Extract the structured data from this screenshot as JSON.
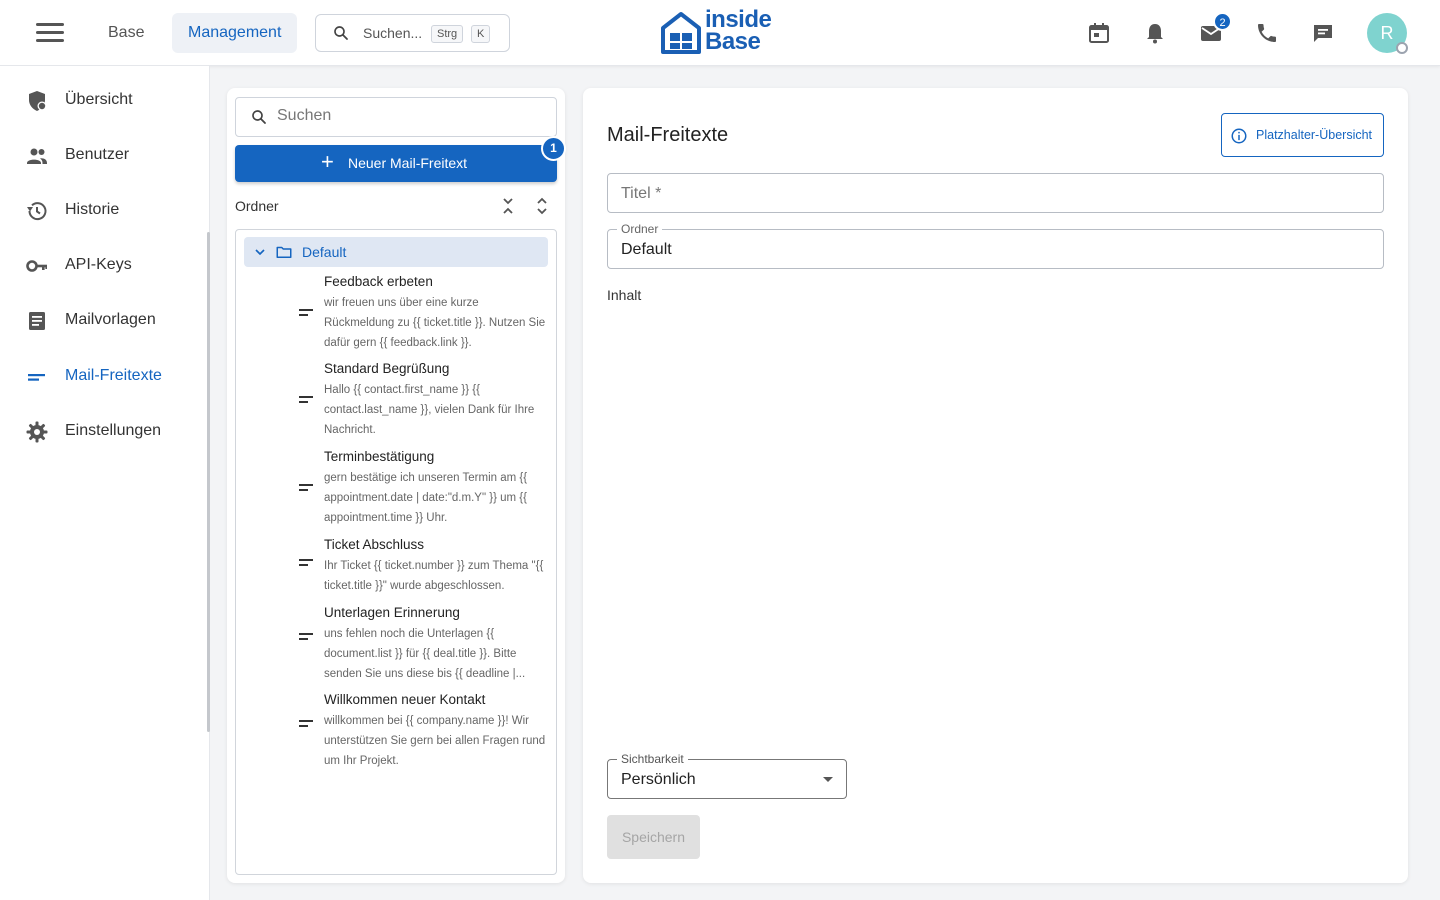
{
  "header": {
    "tabs": [
      {
        "label": "Base",
        "active": false
      },
      {
        "label": "Management",
        "active": true
      }
    ],
    "search": {
      "placeholder": "Suchen...",
      "kbd1": "Strg",
      "kbd2": "K"
    },
    "logo": {
      "line1": "inside",
      "line2": "Base"
    },
    "icons": [
      "calendar-icon",
      "bell-icon",
      "mail-icon",
      "phone-icon",
      "chat-icon"
    ],
    "mail_badge": "2",
    "avatar_initial": "R"
  },
  "sidebar": {
    "items": [
      {
        "label": "Übersicht",
        "icon": "shield-icon",
        "active": false
      },
      {
        "label": "Benutzer",
        "icon": "people-icon",
        "active": false
      },
      {
        "label": "Historie",
        "icon": "history-icon",
        "active": false
      },
      {
        "label": "API-Keys",
        "icon": "key-icon",
        "active": false
      },
      {
        "label": "Mailvorlagen",
        "icon": "document-icon",
        "active": false
      },
      {
        "label": "Mail-Freitexte",
        "icon": "short-text-icon",
        "active": true
      },
      {
        "label": "Einstellungen",
        "icon": "gear-icon",
        "active": false
      }
    ]
  },
  "left_panel": {
    "search_placeholder": "Suchen",
    "new_button": "Neuer Mail-Freitext",
    "new_badge": "1",
    "ordner_label": "Ordner",
    "folder": "Default",
    "entries": [
      {
        "title": "Feedback erbeten",
        "text": "wir freuen uns über eine kurze Rückmeldung zu {{ ticket.title }}. Nutzen Sie dafür gern {{ feedback.link }}."
      },
      {
        "title": "Standard Begrüßung",
        "text": "Hallo {{ contact.first_name }} {{ contact.last_name }}, vielen Dank für Ihre Nachricht."
      },
      {
        "title": "Terminbestätigung",
        "text": "gern bestätige ich unseren Termin am {{ appointment.date | date:\"d.m.Y\" }} um {{ appointment.time }} Uhr."
      },
      {
        "title": "Ticket Abschluss",
        "text": "Ihr Ticket {{ ticket.number }} zum Thema \"{{ ticket.title }}\" wurde abgeschlossen."
      },
      {
        "title": "Unterlagen Erinnerung",
        "text": "uns fehlen noch die Unterlagen {{ document.list }} für {{ deal.title }}. Bitte senden Sie uns diese bis {{ deadline |..."
      },
      {
        "title": "Willkommen neuer Kontakt",
        "text": "willkommen bei {{ company.name }}! Wir unterstützen Sie gern bei allen Fragen rund um Ihr Projekt."
      }
    ]
  },
  "right_panel": {
    "title": "Mail-Freitexte",
    "placeholder_button": "Platzhalter-Übersicht",
    "title_field_placeholder": "Titel *",
    "ordner_legend": "Ordner",
    "ordner_value": "Default",
    "inhalt_label": "Inhalt",
    "visibility_legend": "Sichtbarkeit",
    "visibility_value": "Persönlich",
    "save_button": "Speichern"
  },
  "colors": {
    "primary": "#1565c0",
    "selected_bg": "#dfe7f3",
    "avatar": "#7fd3cf"
  }
}
